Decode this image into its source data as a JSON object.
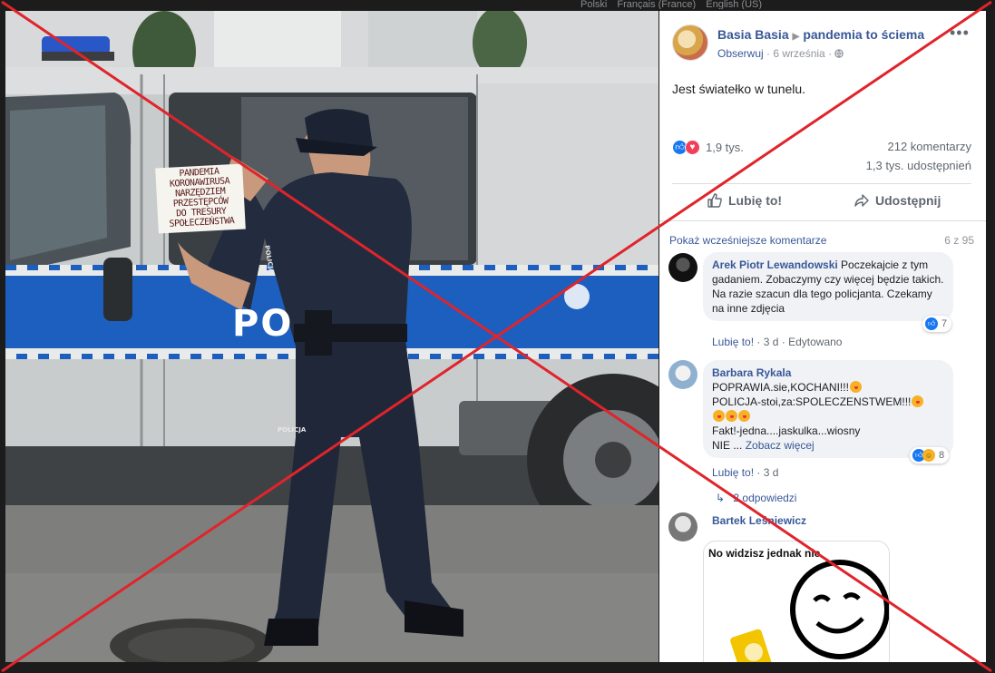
{
  "lang_bar": [
    "Polski",
    "Français (France)",
    "English (US)"
  ],
  "photo": {
    "sign_lines": [
      "PANDEMIA",
      "KORONAWIRUSA",
      "NARZĘDZIEM",
      "PRZESTĘPCÓW",
      "DO TRESURY",
      "SPOŁECZEŃSTWA"
    ],
    "van_text": "PO",
    "badge_text": "POLICJA"
  },
  "post": {
    "author": "Basia Basia",
    "group": "pandemia to ściema",
    "follow": "Obserwuj",
    "date": "6 września",
    "more_icon": "ellipsis-icon",
    "text": "Jest światełko w tunelu.",
    "reaction_count": "1,9 tys.",
    "comments_count": "212 komentarzy",
    "shares_count": "1,3 tys. udostępnień",
    "like_label": "Lubię to!",
    "share_label": "Udostępnij"
  },
  "comments": {
    "previous_label": "Pokaż wcześniejsze komentarze",
    "count_label": "6 z 95",
    "items": [
      {
        "name": "Arek Piotr Lewandowski",
        "text": "Poczekajcie z tym gadaniem. Zobaczymy czy więcej będzie takich. Na razie szacun dla tego policjanta. Czekamy na inne zdjęcia",
        "like": "Lubię to!",
        "time": "3 d",
        "edited": "Edytowano",
        "reactions": "7"
      },
      {
        "name": "Barbara Rykala",
        "line1": "POPRAWIA.sie,KOCHANI!!!",
        "line2": "POLICJA-stoi,za:SPOLECZENSTWEM!!!",
        "line3": "Fakt!-jedna....jaskulka...wiosny",
        "line4": "NIE ...",
        "see_more": "Zobacz więcej",
        "like": "Lubię to!",
        "time": "3 d",
        "reactions": "8",
        "replies": "2 odpowiedzi"
      },
      {
        "name": "Bartek Leśniewicz",
        "meme_text": "No widzisz jednak nie"
      }
    ]
  },
  "colors": {
    "link": "#385898",
    "overlay_x": "#e0242b",
    "like_blue": "#1877f2",
    "love_red": "#f33e58"
  }
}
